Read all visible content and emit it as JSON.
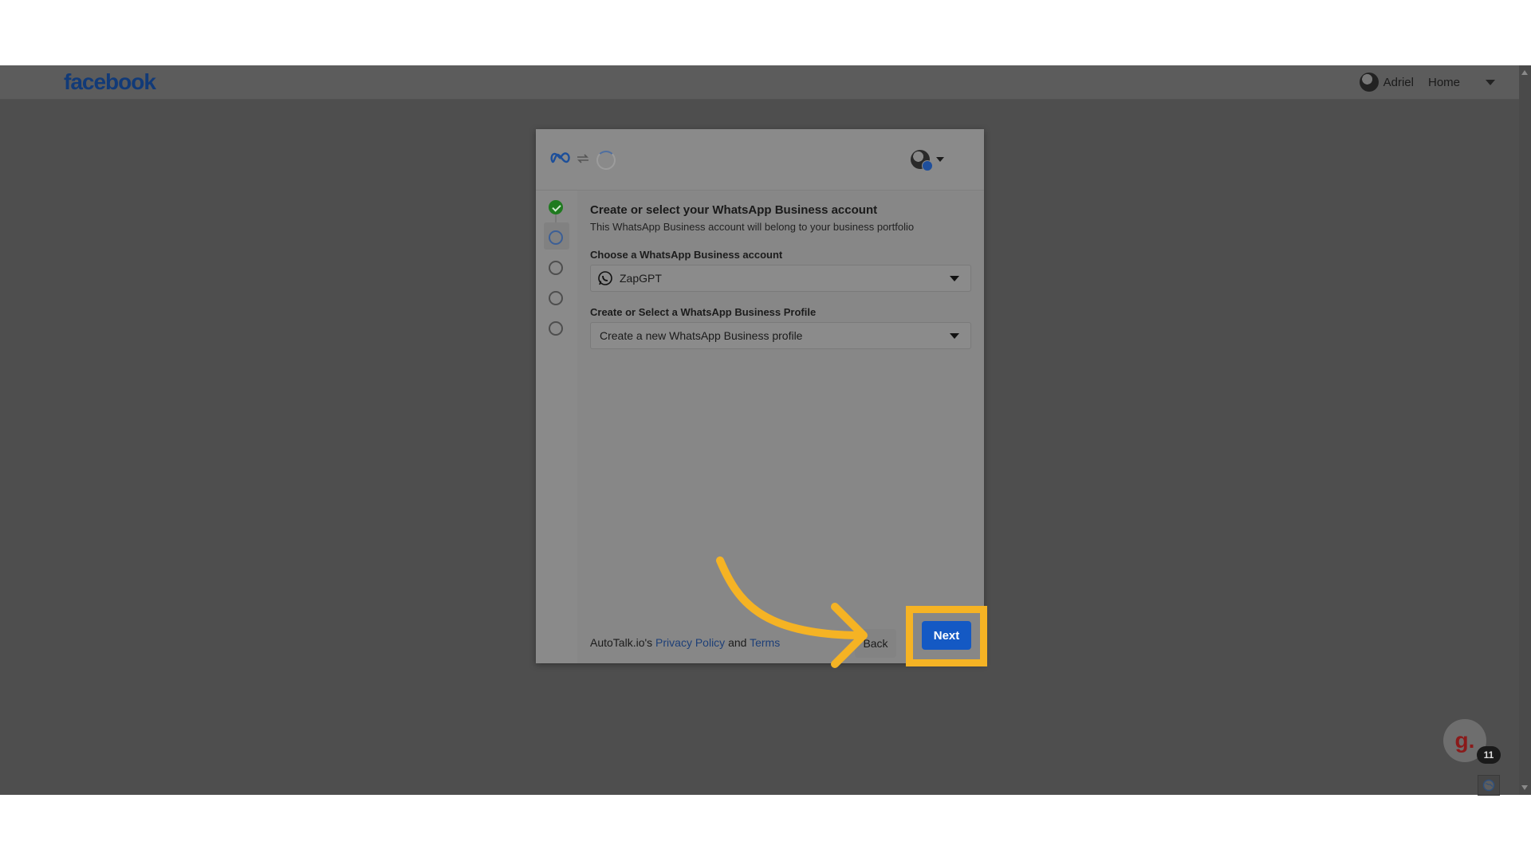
{
  "header": {
    "logo": "facebook",
    "user_name": "Adriel",
    "home_label": "Home"
  },
  "dialog": {
    "icons": [
      "meta-logo-icon",
      "sync-icon",
      "spinner-icon"
    ],
    "title": "Create or select your WhatsApp Business account",
    "subtitle": "This WhatsApp Business account will belong to your business portfolio",
    "account_field": {
      "label": "Choose a WhatsApp Business account",
      "value": "ZapGPT"
    },
    "profile_field": {
      "label": "Create or Select a WhatsApp Business Profile",
      "value": "Create a new WhatsApp Business profile"
    },
    "footer": {
      "prefix": "AutoTalk.io's",
      "privacy_link": "Privacy Policy",
      "and": "and",
      "terms_link": "Terms"
    },
    "back_label": "Back",
    "next_label": "Next",
    "steps": [
      "done",
      "current",
      "pending",
      "pending",
      "pending"
    ]
  },
  "widget": {
    "letter": "g.",
    "badge": "11"
  },
  "colors": {
    "highlight": "#f5b324",
    "next_button": "#1459c4"
  }
}
